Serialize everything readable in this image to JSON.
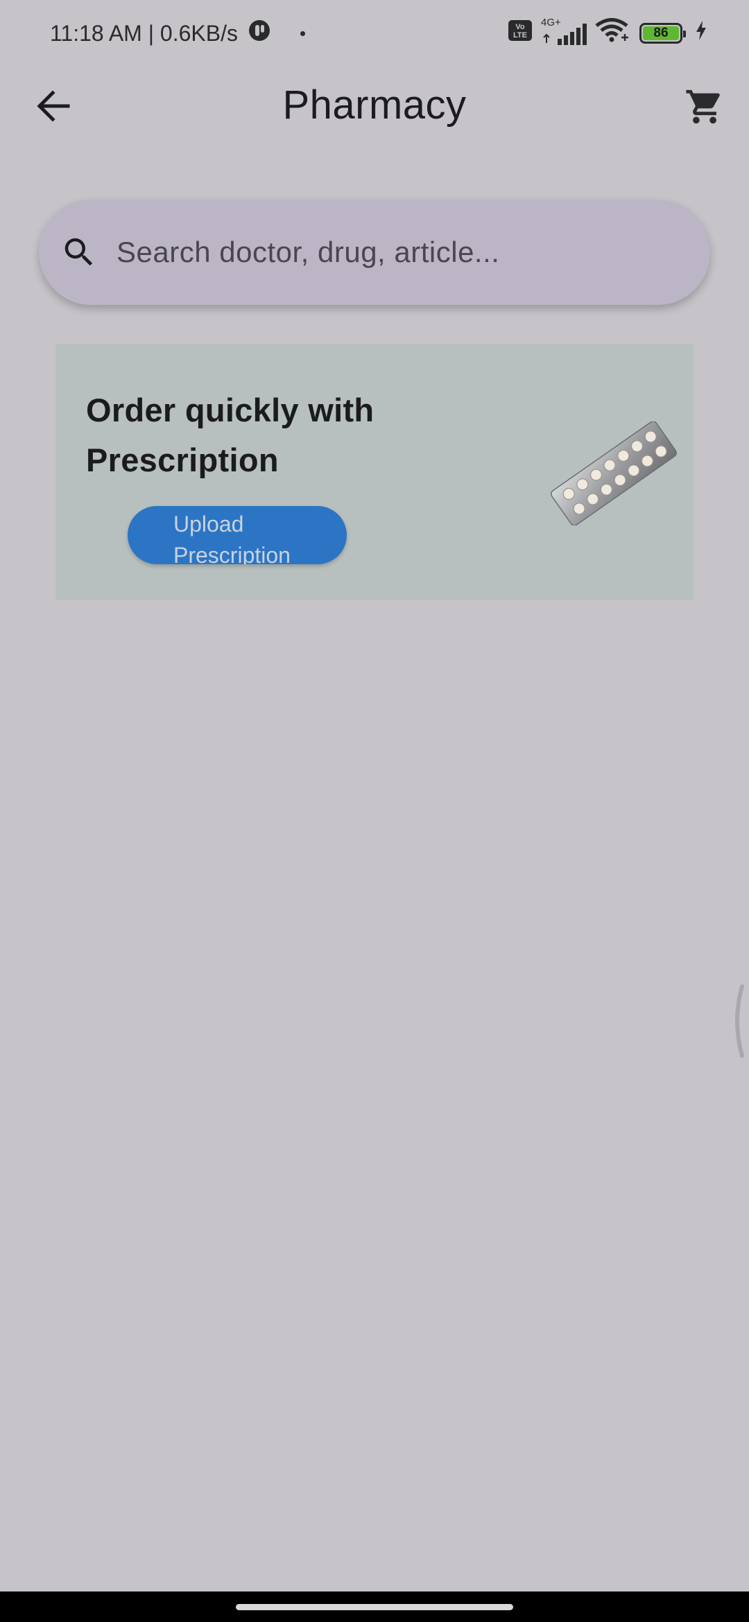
{
  "status_bar": {
    "time_speed": "11:18 AM | 0.6KB/s",
    "network_type": "4G+",
    "volte": "Vo\nLTE",
    "battery_level": "86",
    "icons": [
      "app-notification-icon",
      "volte-icon",
      "signal-icon",
      "wifi-icon",
      "battery-icon",
      "charging-icon"
    ]
  },
  "app_bar": {
    "title": "Pharmacy",
    "back_icon": "arrow-left-icon",
    "cart_icon": "cart-icon"
  },
  "search": {
    "placeholder": "Search doctor, drug, article...",
    "value": "",
    "icon": "search-icon"
  },
  "promo": {
    "title": "Order quickly with Prescription",
    "button_label": "Upload Prescription",
    "image_icon": "pill-blister-pack-icon",
    "colors": {
      "card_bg": "#b7c0bf",
      "button_bg": "#2c75c5"
    }
  },
  "colors": {
    "page_bg": "#c6c4c8",
    "search_bg": "#bbb5c5"
  }
}
